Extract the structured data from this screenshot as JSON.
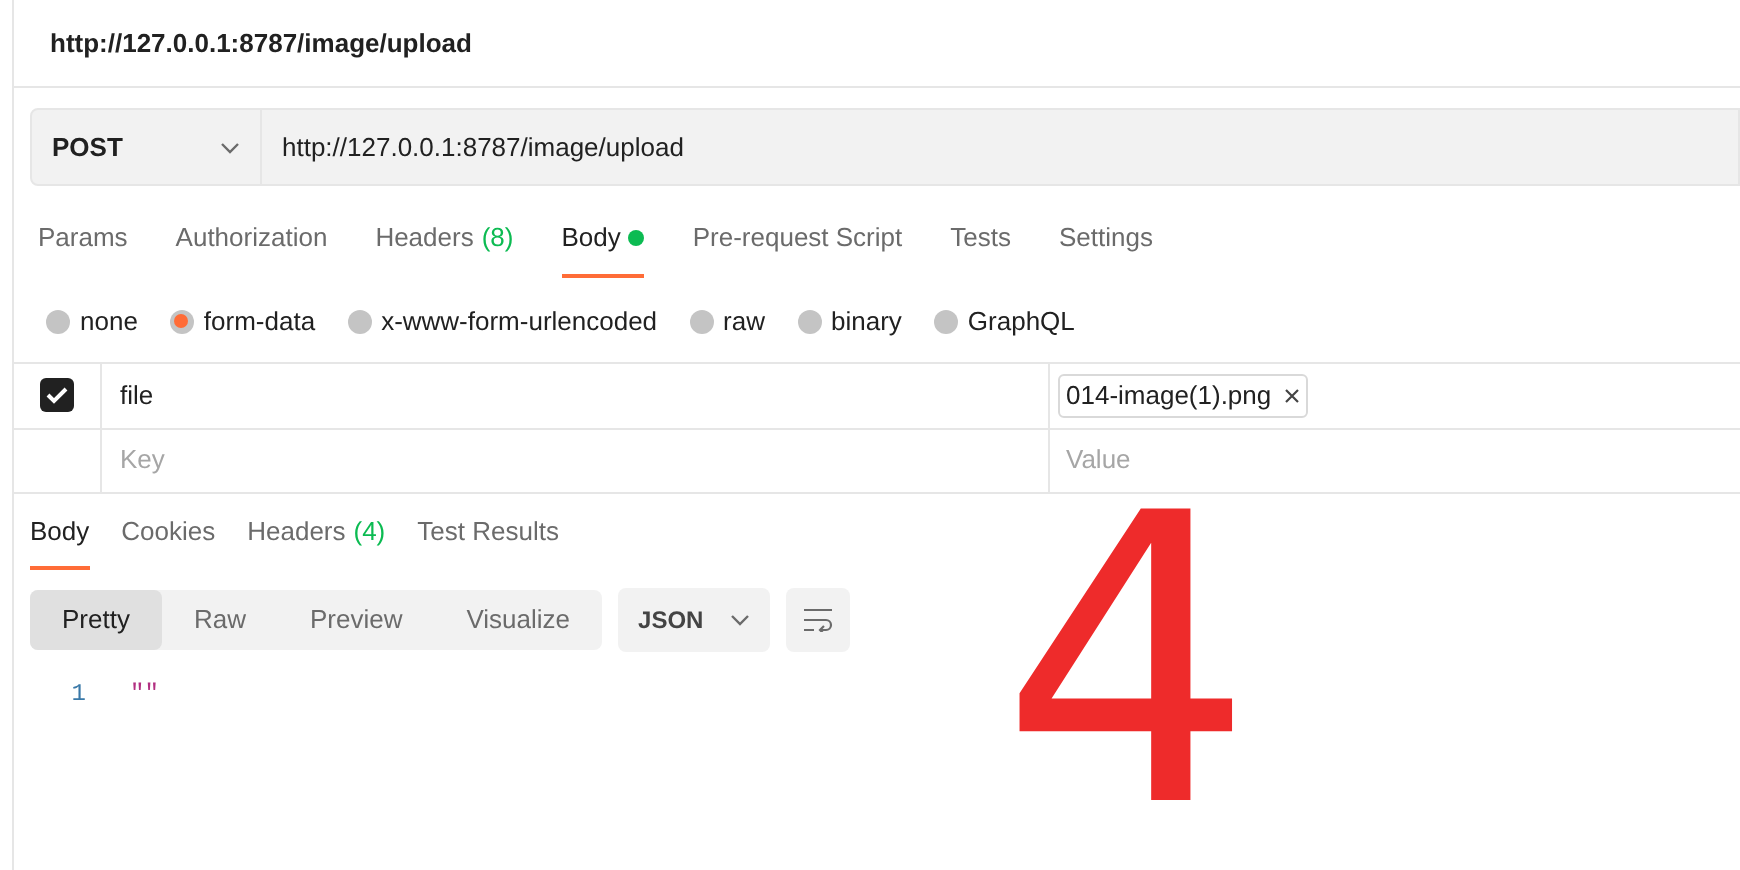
{
  "window": {
    "title": "http://127.0.0.1:8787/image/upload"
  },
  "request": {
    "method": "POST",
    "url": "http://127.0.0.1:8787/image/upload"
  },
  "request_tabs": [
    {
      "label": "Params",
      "selected": false
    },
    {
      "label": "Authorization",
      "selected": false
    },
    {
      "label": "Headers",
      "count": "(8)",
      "selected": false
    },
    {
      "label": "Body",
      "dot": true,
      "selected": true
    },
    {
      "label": "Pre-request Script",
      "selected": false
    },
    {
      "label": "Tests",
      "selected": false
    },
    {
      "label": "Settings",
      "selected": false
    }
  ],
  "body_types": [
    {
      "label": "none",
      "selected": false
    },
    {
      "label": "form-data",
      "selected": true
    },
    {
      "label": "x-www-form-urlencoded",
      "selected": false
    },
    {
      "label": "raw",
      "selected": false
    },
    {
      "label": "binary",
      "selected": false
    },
    {
      "label": "GraphQL",
      "selected": false
    }
  ],
  "form_rows": [
    {
      "checked": true,
      "key": "file",
      "file": "014-image(1).png"
    },
    {
      "key_placeholder": "Key",
      "value_placeholder": "Value"
    }
  ],
  "response_tabs": [
    {
      "label": "Body",
      "selected": true
    },
    {
      "label": "Cookies",
      "selected": false
    },
    {
      "label": "Headers",
      "count": "(4)",
      "selected": false
    },
    {
      "label": "Test Results",
      "selected": false
    }
  ],
  "view_modes": [
    {
      "label": "Pretty",
      "selected": true
    },
    {
      "label": "Raw",
      "selected": false
    },
    {
      "label": "Preview",
      "selected": false
    },
    {
      "label": "Visualize",
      "selected": false
    }
  ],
  "format": "JSON",
  "code_lines": [
    {
      "number": "1",
      "text": "\"\""
    }
  ],
  "annotation": "4"
}
